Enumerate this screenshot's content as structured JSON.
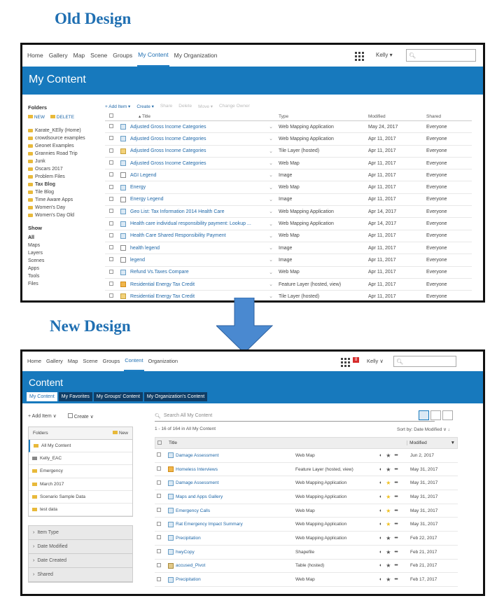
{
  "headings": {
    "old": "Old Design",
    "new": "New Design"
  },
  "old": {
    "nav": [
      "Home",
      "Gallery",
      "Map",
      "Scene",
      "Groups",
      "My Content",
      "My Organization"
    ],
    "user": "Kelly ▾",
    "banner_title": "My Content",
    "actions": {
      "add": "+ Add Item ▾",
      "create": "Create ▾",
      "share": "Share",
      "delete": "Delete",
      "move": "Move ▾",
      "change_owner": "Change Owner"
    },
    "folders_label": "Folders",
    "new_label": "NEW",
    "delete_label": "DELETE",
    "folders": [
      "Karate_KElly (Home)",
      "crowdsource examples",
      "Geonet Examples",
      "Grannies Road Trip",
      "Junk",
      "Oscars 2017",
      "Problem Files",
      "Tax Blog",
      "Tile Blog",
      "Time Aware Apps",
      "Women's Day",
      "Women's Day Old"
    ],
    "show_label": "Show",
    "show": [
      "All",
      "Maps",
      "Layers",
      "Scenes",
      "Apps",
      "Tools",
      "Files"
    ],
    "columns": {
      "title": "▴ Title",
      "type": "Type",
      "modified": "Modified",
      "shared": "Shared"
    },
    "rows": [
      {
        "t": "Adjusted Gross Income Categories",
        "ty": "Web Mapping Application",
        "m": "May 24, 2017",
        "s": "Everyone",
        "i": "app"
      },
      {
        "t": "Adjusted Gross Income Categories",
        "ty": "Web Mapping Application",
        "m": "Apr 11, 2017",
        "s": "Everyone",
        "i": "app"
      },
      {
        "t": "Adjusted Gross Income Categories",
        "ty": "Tile Layer (hosted)",
        "m": "Apr 11, 2017",
        "s": "Everyone",
        "i": "tile"
      },
      {
        "t": "Adjusted Gross Income Categories",
        "ty": "Web Map",
        "m": "Apr 11, 2017",
        "s": "Everyone",
        "i": "app"
      },
      {
        "t": "AGI Legend",
        "ty": "Image",
        "m": "Apr 11, 2017",
        "s": "Everyone",
        "i": "img"
      },
      {
        "t": "Energy",
        "ty": "Web Map",
        "m": "Apr 11, 2017",
        "s": "Everyone",
        "i": "app"
      },
      {
        "t": "Energy Legend",
        "ty": "Image",
        "m": "Apr 11, 2017",
        "s": "Everyone",
        "i": "img"
      },
      {
        "t": "Geo List: Tax Information 2014 Health Care",
        "ty": "Web Mapping Application",
        "m": "Apr 14, 2017",
        "s": "Everyone",
        "i": "app"
      },
      {
        "t": "Health care individual responsibility payment: Lookup ...",
        "ty": "Web Mapping Application",
        "m": "Apr 14, 2017",
        "s": "Everyone",
        "i": "app"
      },
      {
        "t": "Health Care Shared Responsibility Payment",
        "ty": "Web Map",
        "m": "Apr 11, 2017",
        "s": "Everyone",
        "i": "app"
      },
      {
        "t": "health legend",
        "ty": "Image",
        "m": "Apr 11, 2017",
        "s": "Everyone",
        "i": "img"
      },
      {
        "t": "legend",
        "ty": "Image",
        "m": "Apr 11, 2017",
        "s": "Everyone",
        "i": "img"
      },
      {
        "t": "Refund Vs.Taxes Compare",
        "ty": "Web Map",
        "m": "Apr 11, 2017",
        "s": "Everyone",
        "i": "app"
      },
      {
        "t": "Residential Energy Tax Credit",
        "ty": "Feature Layer (hosted, view)",
        "m": "Apr 11, 2017",
        "s": "Everyone",
        "i": "feat"
      },
      {
        "t": "Residential Energy Tax Credit",
        "ty": "Tile Layer (hosted)",
        "m": "Apr 11, 2017",
        "s": "Everyone",
        "i": "tile"
      }
    ]
  },
  "new": {
    "nav": [
      "Home",
      "Gallery",
      "Map",
      "Scene",
      "Groups",
      "Content",
      "Organization"
    ],
    "badge": "8",
    "user": "Kelly ∨",
    "banner_title": "Content",
    "tabs": [
      "My Content",
      "My Favorites",
      "My Groups' Content",
      "My Organization's Content"
    ],
    "add": "+ Add Item ∨",
    "create": "Create ∨",
    "search_placeholder": "Search All My Content",
    "count": "1 - 16 of 164 in All My Content",
    "sort": "Sort by: Date Modified ∨ ↓",
    "folders_label": "Folders",
    "new_label": "New",
    "folders": [
      "All My Content",
      "Kelly_EAC",
      "Emergency",
      "March 2017",
      "Scenario Sample Data",
      "test data"
    ],
    "filters": [
      "Item Type",
      "Date Modified",
      "Date Created",
      "Shared"
    ],
    "columns": {
      "title": "Title",
      "modified": "Modified"
    },
    "rows": [
      {
        "t": "Damage Assessment",
        "ty": "Web Map",
        "m": "Jun 2, 2017",
        "star": false,
        "i": "app"
      },
      {
        "t": "Homeless Interviews",
        "ty": "Feature Layer (hosted, view)",
        "m": "May 31, 2017",
        "star": false,
        "i": "feat"
      },
      {
        "t": "Damage Assessment",
        "ty": "Web Mapping Application",
        "m": "May 31, 2017",
        "star": true,
        "i": "app"
      },
      {
        "t": "Maps and Apps Gallery",
        "ty": "Web Mapping Application",
        "m": "May 31, 2017",
        "star": true,
        "i": "app"
      },
      {
        "t": "Emergency Calls",
        "ty": "Web Map",
        "m": "May 31, 2017",
        "star": true,
        "i": "app"
      },
      {
        "t": "Rat Emergency Impact Summary",
        "ty": "Web Mapping Application",
        "m": "May 31, 2017",
        "star": true,
        "i": "app"
      },
      {
        "t": "Precipitation",
        "ty": "Web Mapping Application",
        "m": "Feb 22, 2017",
        "star": false,
        "i": "app"
      },
      {
        "t": "hwyCopy",
        "ty": "Shapefile",
        "m": "Feb 21, 2017",
        "star": false,
        "i": "app"
      },
      {
        "t": "accused_Pivot",
        "ty": "Table (hosted)",
        "m": "Feb 21, 2017",
        "star": false,
        "i": "table"
      },
      {
        "t": "Precipitation",
        "ty": "Web Map",
        "m": "Feb 17, 2017",
        "star": false,
        "i": "app"
      }
    ]
  }
}
